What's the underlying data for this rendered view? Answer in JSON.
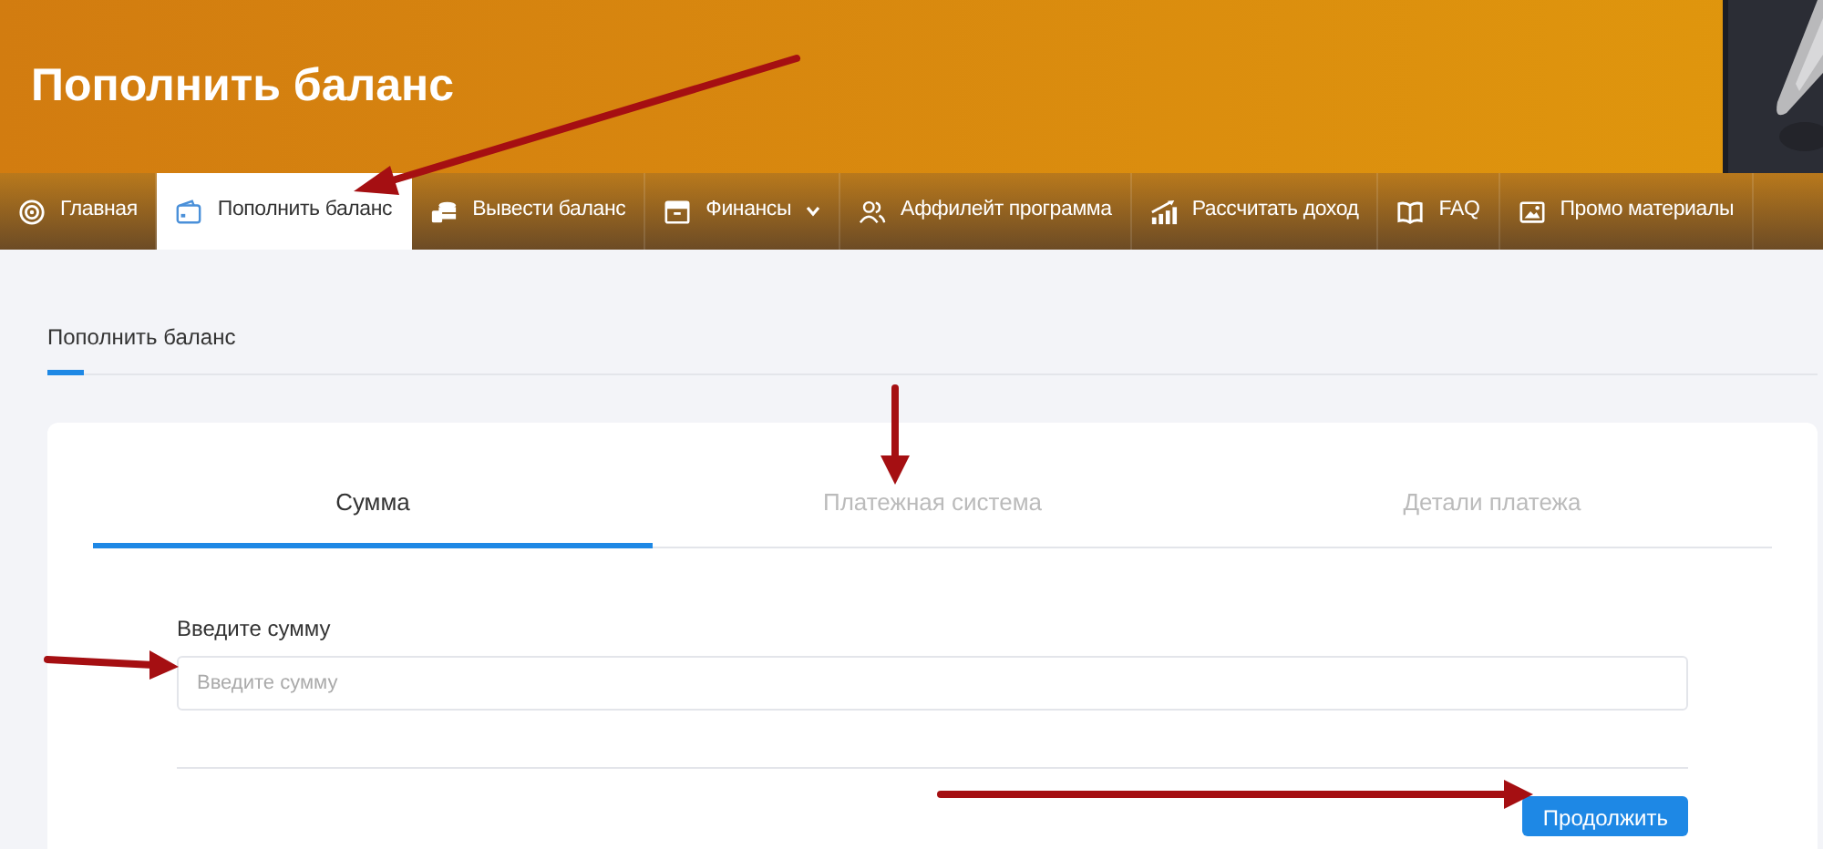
{
  "header": {
    "title": "Пополнить баланс"
  },
  "nav": [
    {
      "label": "Главная",
      "selected": false,
      "has_menu": false
    },
    {
      "label": "Пополнить баланс",
      "selected": true,
      "has_menu": false
    },
    {
      "label": "Вывести баланс",
      "selected": false,
      "has_menu": false
    },
    {
      "label": "Финансы",
      "selected": false,
      "has_menu": true
    },
    {
      "label": "Аффилейт программа",
      "selected": false,
      "has_menu": false
    },
    {
      "label": "Рассчитать доход",
      "selected": false,
      "has_menu": false
    },
    {
      "label": "FAQ",
      "selected": false,
      "has_menu": false
    },
    {
      "label": "Промо материалы",
      "selected": false,
      "has_menu": false
    }
  ],
  "section": {
    "title": "Пополнить баланс"
  },
  "steps": [
    {
      "label": "Сумма",
      "selected": true
    },
    {
      "label": "Платежная система",
      "selected": false
    },
    {
      "label": "Детали платежа",
      "selected": false
    }
  ],
  "form": {
    "label": "Введите сумму",
    "placeholder": "Введите сумму"
  },
  "submit": "Продолжить"
}
